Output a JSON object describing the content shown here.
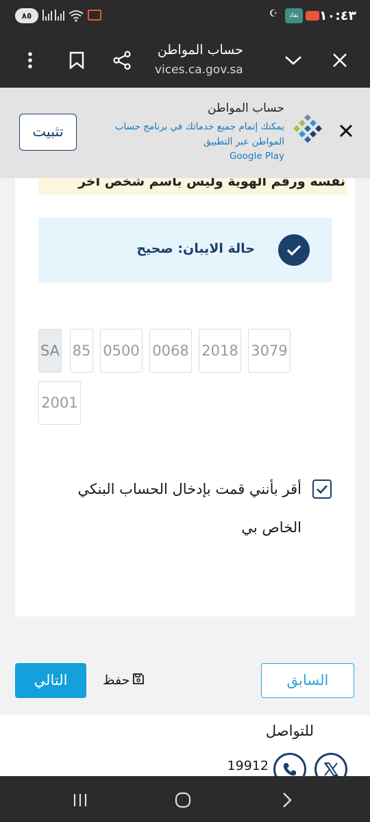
{
  "status_bar": {
    "time": "١٠:٤٣",
    "battery": "٨٥",
    "nafath": "نفاذ"
  },
  "toolbar": {
    "title": "حساب المواطن",
    "url": "vices.ca.gov.sa"
  },
  "banner": {
    "app_name": "حساب المواطن",
    "description": "يمكنك إتمام جميع خدماتك في برنامج حساب المواطن عبر التطبيق",
    "store": "Google Play",
    "install_label": "تثبيت"
  },
  "notice": {
    "text": "نفسه ورقم الهوية وليس باسم شخص اخر"
  },
  "iban_status": {
    "label": "حالة الايبان: صحيح"
  },
  "iban": {
    "country": "SA",
    "check_digits": "85",
    "groups": [
      "0500",
      "0068",
      "2018",
      "3079",
      "2001"
    ]
  },
  "consent": {
    "text": "أقر بأنني قمت بإدخال الحساب البنكي الخاص بي",
    "checked": true
  },
  "actions": {
    "previous": "السابق",
    "save": "حفظ",
    "next": "التالي"
  },
  "footer": {
    "contact_title": "للتواصل",
    "phone": "19912"
  },
  "colors": {
    "primary_navy": "#1d3f6c",
    "accent_blue": "#13a0dd",
    "status_bg": "#e6f4fb"
  }
}
